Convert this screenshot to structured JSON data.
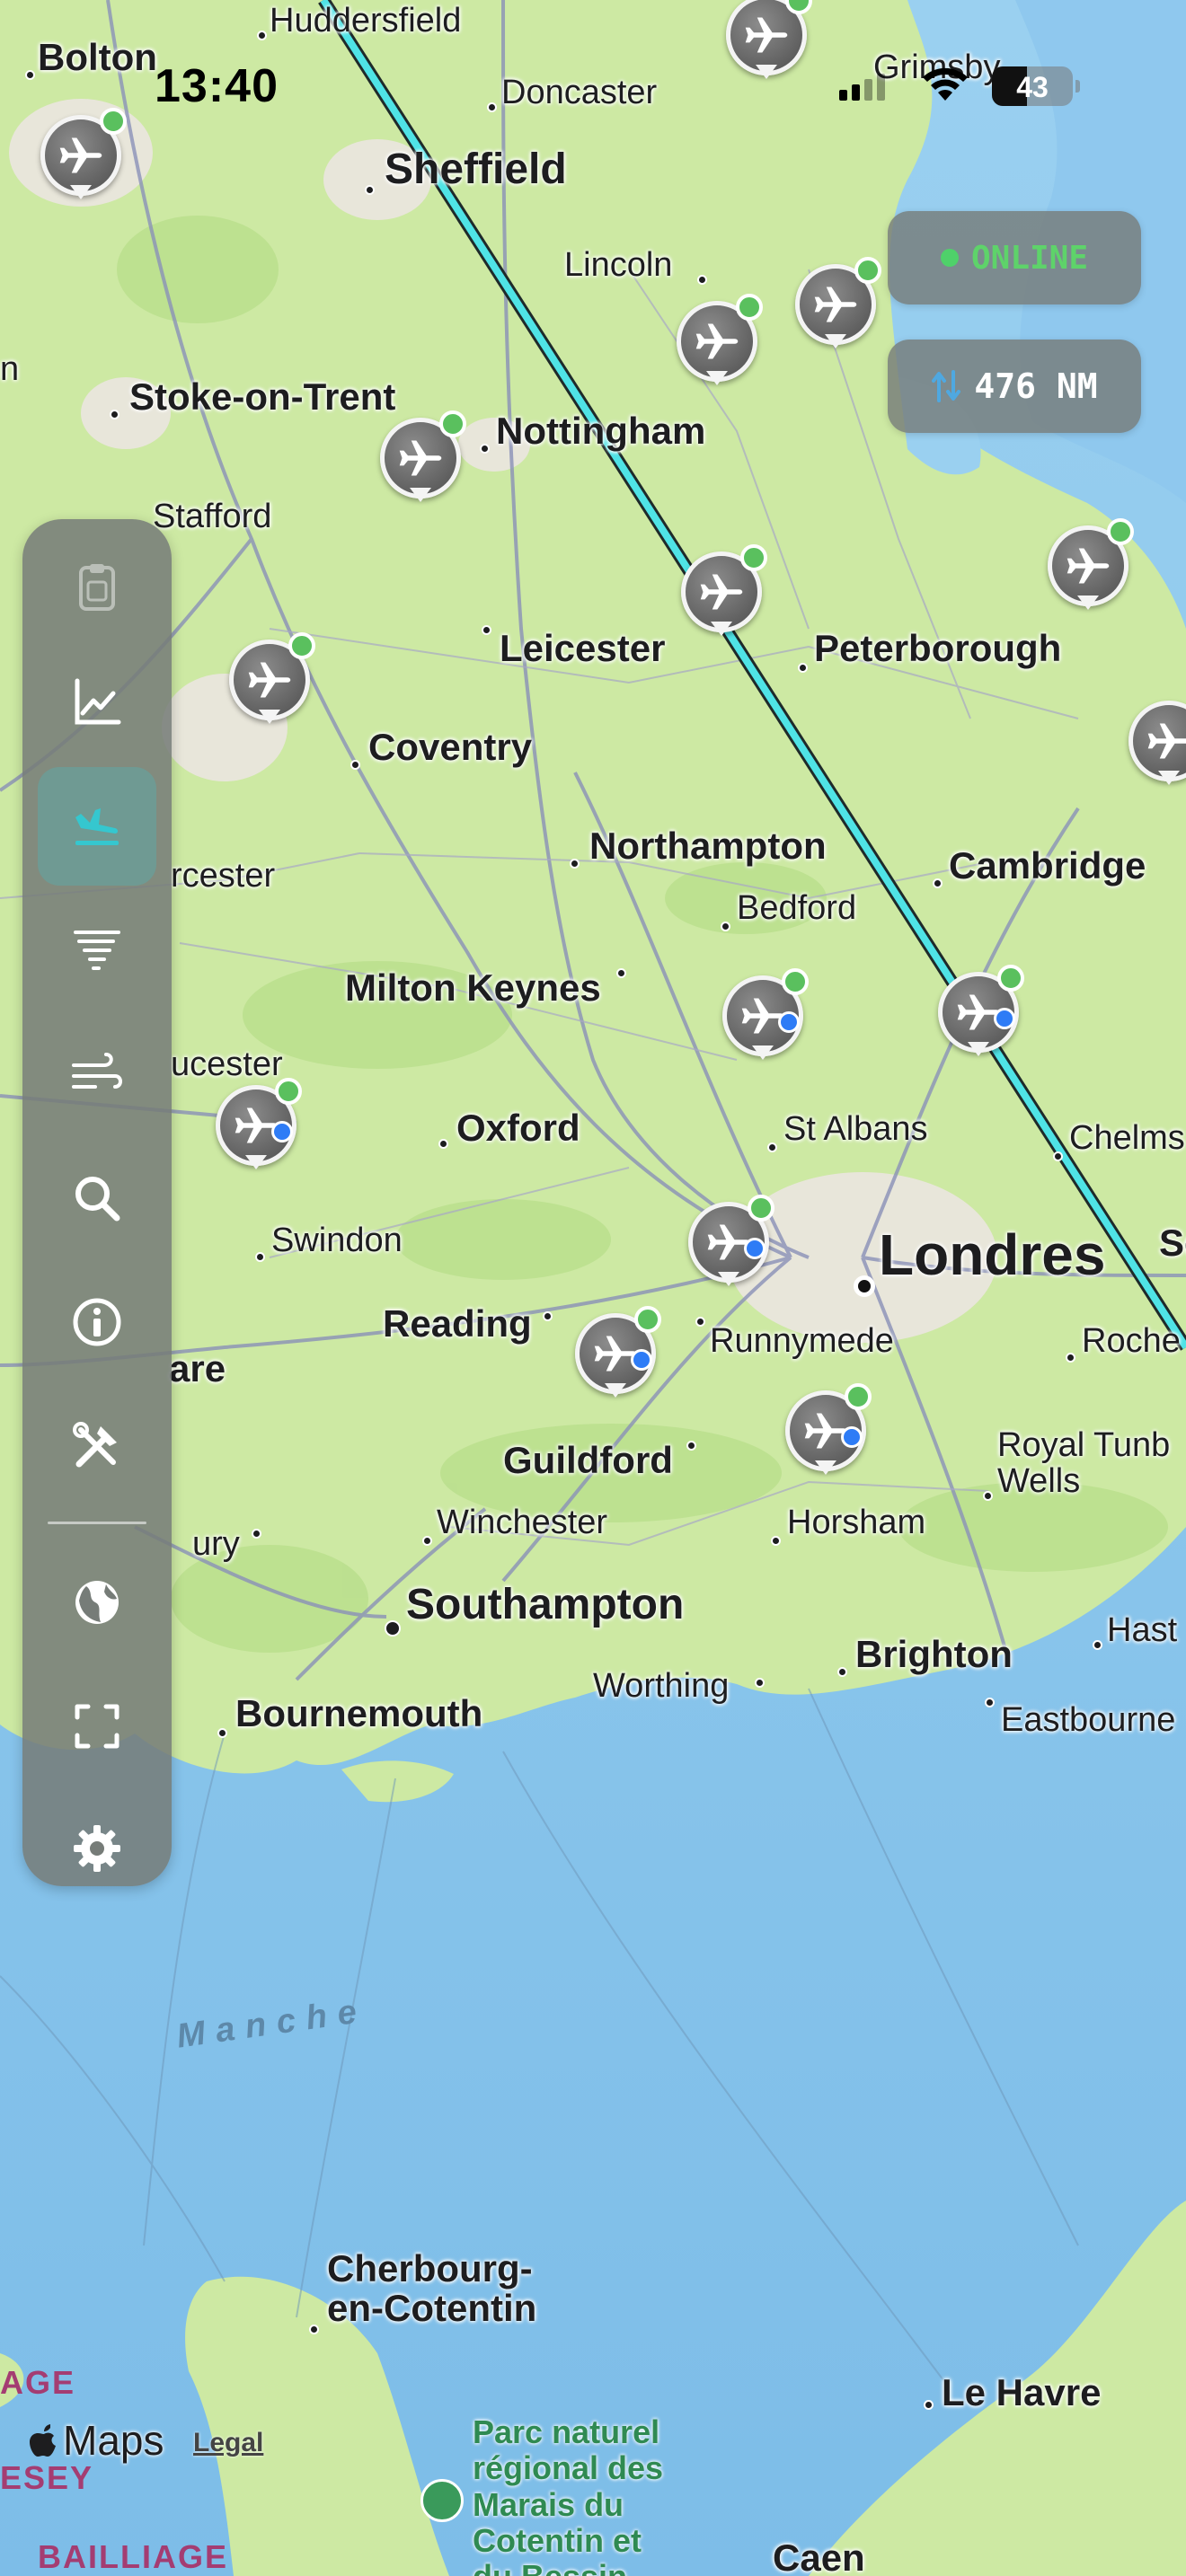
{
  "status_bar": {
    "time": "13:40",
    "battery_percent": "43",
    "battery_level": 0.43,
    "wifi_icon": "wifi-icon",
    "cellular_icon": "cellular-icon"
  },
  "overlay": {
    "online_label": "ONLINE",
    "online_color": "#5ed36a",
    "distance_label": "476 NM",
    "distance_icon": "route-arrows-icon"
  },
  "toolbar": {
    "items": [
      {
        "name": "clipboard",
        "icon": "clipboard-icon",
        "state": "disabled"
      },
      {
        "name": "chart",
        "icon": "chart-icon",
        "state": "normal"
      },
      {
        "name": "arrival",
        "icon": "plane-landing-icon",
        "state": "active"
      },
      {
        "name": "weather-tornado",
        "icon": "tornado-icon",
        "state": "normal"
      },
      {
        "name": "wind",
        "icon": "wind-icon",
        "state": "normal"
      },
      {
        "name": "search",
        "icon": "search-icon",
        "state": "normal"
      },
      {
        "name": "info",
        "icon": "info-icon",
        "state": "normal"
      },
      {
        "name": "tools",
        "icon": "tools-icon",
        "state": "normal"
      },
      {
        "name": "globe",
        "icon": "globe-icon",
        "state": "normal"
      },
      {
        "name": "fullscreen",
        "icon": "fullscreen-icon",
        "state": "normal"
      },
      {
        "name": "settings",
        "icon": "gear-icon",
        "state": "normal"
      }
    ],
    "accent_color": "#35c7cf"
  },
  "map": {
    "places": [
      {
        "label": "Bolton",
        "size": "medium"
      },
      {
        "label": "Huddersfield",
        "size": "small"
      },
      {
        "label": "Doncaster",
        "size": "small"
      },
      {
        "label": "Sheffield",
        "size": "large"
      },
      {
        "label": "Grimsby",
        "size": "small"
      },
      {
        "label": "Lincoln",
        "size": "small"
      },
      {
        "label": "Stoke-on-Trent",
        "size": "medium"
      },
      {
        "label": "Nottingham",
        "size": "medium"
      },
      {
        "label": "Stafford",
        "size": "small"
      },
      {
        "label": "Leicester",
        "size": "medium"
      },
      {
        "label": "Peterborough",
        "size": "medium"
      },
      {
        "label": "Coventry",
        "size": "medium"
      },
      {
        "label": "Northampton",
        "size": "medium"
      },
      {
        "label": "Cambridge",
        "size": "medium"
      },
      {
        "label": "rcester",
        "size": "small"
      },
      {
        "label": "Bedford",
        "size": "small"
      },
      {
        "label": "Milton Keynes",
        "size": "medium"
      },
      {
        "label": "ucester",
        "size": "small"
      },
      {
        "label": "Oxford",
        "size": "medium"
      },
      {
        "label": "St Albans",
        "size": "small"
      },
      {
        "label": "Chelms",
        "size": "small"
      },
      {
        "label": "Swindon",
        "size": "small"
      },
      {
        "label": "Londres",
        "size": "capital"
      },
      {
        "label": "Se",
        "size": "medium"
      },
      {
        "label": "Reading",
        "size": "medium"
      },
      {
        "label": "Runnymede",
        "size": "small"
      },
      {
        "label": "Roche",
        "size": "small"
      },
      {
        "label": "are",
        "size": "medium"
      },
      {
        "label": "Royal Tunb\nWells",
        "size": "small"
      },
      {
        "label": "Guildford",
        "size": "medium"
      },
      {
        "label": "ury",
        "size": "small"
      },
      {
        "label": "Winchester",
        "size": "small"
      },
      {
        "label": "Horsham",
        "size": "small"
      },
      {
        "label": "Southampton",
        "size": "large"
      },
      {
        "label": "Hast",
        "size": "small"
      },
      {
        "label": "Worthing",
        "size": "small"
      },
      {
        "label": "Brighton",
        "size": "medium"
      },
      {
        "label": "Eastbourne",
        "size": "small"
      },
      {
        "label": "Bournemouth",
        "size": "medium"
      },
      {
        "label": "Cherbourg-\nen-Cotentin",
        "size": "medium"
      },
      {
        "label": "Le Havre",
        "size": "medium"
      },
      {
        "label": "Caen",
        "size": "medium"
      },
      {
        "label": "n",
        "size": "small"
      }
    ],
    "sea_label": "Manche",
    "park_label": "Parc naturel\nrégional des\nMarais du\nCotentin et\ndu Bessin",
    "bailiwicks": [
      "AGE",
      "ESEY",
      "BAILLIAGE"
    ],
    "route_color": "#4fe3e6",
    "aircraft_count": 17,
    "aircraft_status_color": "#5ac05e",
    "aircraft_selected_color": "#2e7cf6"
  },
  "attribution": {
    "maps_label": "Maps",
    "legal_label": "Legal"
  }
}
